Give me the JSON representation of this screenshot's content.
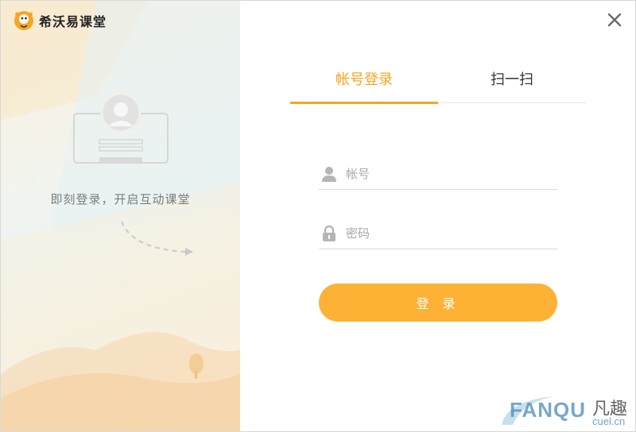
{
  "app": {
    "name": "希沃易课堂",
    "tagline": "即刻登录，开启互动课堂"
  },
  "tabs": [
    {
      "label": "帐号登录",
      "active": true
    },
    {
      "label": "扫一扫",
      "active": false
    }
  ],
  "form": {
    "account_placeholder": "帐号",
    "password_placeholder": "密码",
    "submit_label": "登 录"
  },
  "watermark": {
    "main": "FANQU",
    "cn": "凡趣",
    "sub": "cuel.cn"
  },
  "colors": {
    "accent": "#f5a623",
    "button": "#fdb236"
  },
  "icons": {
    "close": "close-icon",
    "account": "user-icon",
    "password": "lock-icon",
    "logo": "seewo-logo-icon"
  }
}
